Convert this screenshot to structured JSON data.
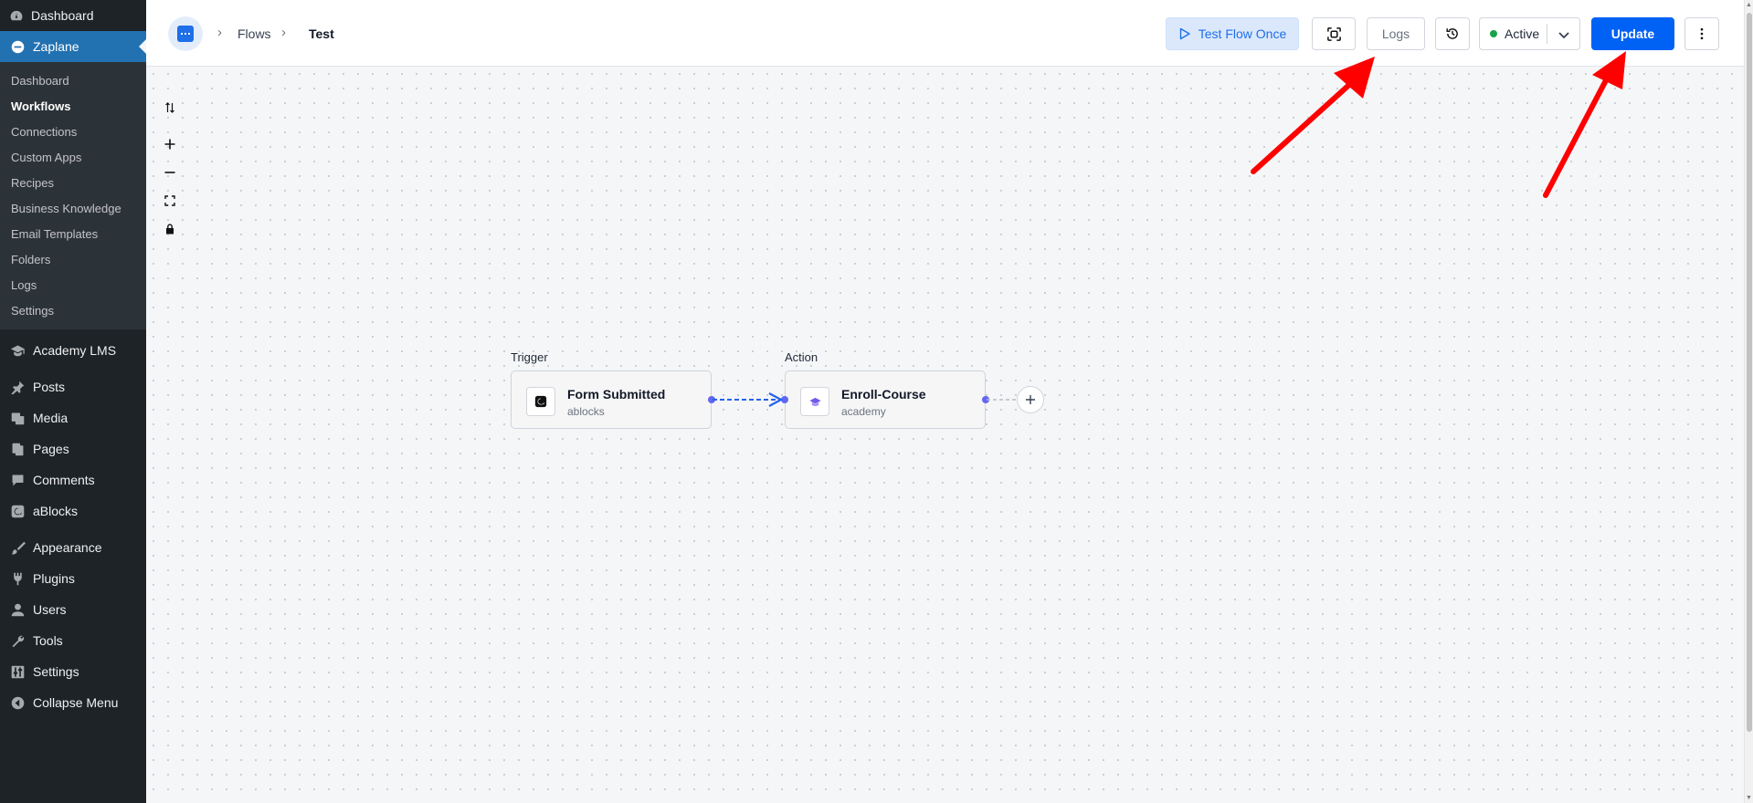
{
  "sidebar": {
    "top_item": "Dashboard",
    "active_item": "Zaplane",
    "submenu": [
      "Dashboard",
      "Workflows",
      "Connections",
      "Custom Apps",
      "Recipes",
      "Business Knowledge",
      "Email Templates",
      "Folders",
      "Logs",
      "Settings"
    ],
    "current_submenu": "Workflows",
    "items": [
      "Academy LMS",
      "Posts",
      "Media",
      "Pages",
      "Comments",
      "aBlocks",
      "Appearance",
      "Plugins",
      "Users",
      "Tools",
      "Settings",
      "Collapse Menu"
    ]
  },
  "breadcrumb": {
    "items": [
      "Flows",
      "Test"
    ]
  },
  "toolbar": {
    "test_flow_once": "Test Flow Once",
    "logs": "Logs",
    "status": "Active",
    "update": "Update"
  },
  "flow": {
    "trigger": {
      "group_label": "Trigger",
      "title": "Form Submitted",
      "app": "ablocks"
    },
    "action": {
      "group_label": "Action",
      "title": "Enroll-Course",
      "app": "academy"
    }
  },
  "colors": {
    "primary": "#0062f5",
    "wp_active": "#2271b1",
    "status_dot": "#16a34a",
    "arrow_annotation": "#ff0000",
    "handle": "#6366f1"
  }
}
